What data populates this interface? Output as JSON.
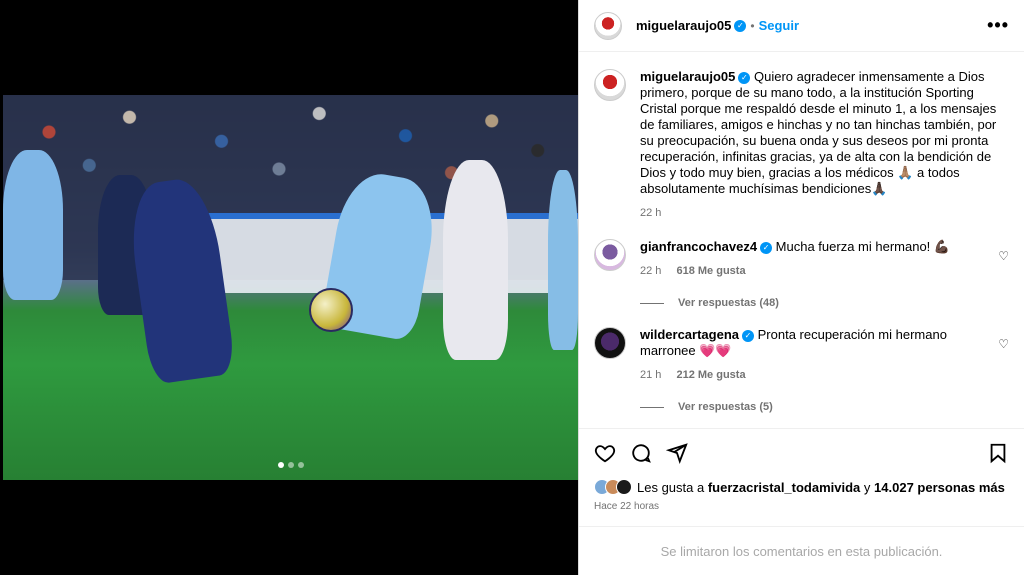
{
  "post": {
    "username": "miguelaraujo05",
    "follow_label": "Seguir",
    "separator": "•",
    "more_label": "•••"
  },
  "caption": {
    "username": "miguelaraujo05",
    "text": "Quiero agradecer inmensamente a Dios primero, porque de su mano todo, a la institución Sporting Cristal porque me respaldó desde el minuto 1, a los mensajes de familiares, amigos e hinchas y no tan hinchas también, por su preocupación, su buena onda y sus deseos por mi pronta recuperación, infinitas gracias, ya de alta con la bendición de Dios y todo muy bien, gracias a los médicos 🙏🏽 a todos absolutamente muchísimas bendiciones🙏🏿",
    "time": "22 h"
  },
  "comments": [
    {
      "username": "gianfrancochavez4",
      "text": "Mucha fuerza mi hermano! 💪🏿",
      "time": "22 h",
      "likes": "618 Me gusta",
      "replies": "Ver respuestas (48)"
    },
    {
      "username": "wildercartagena",
      "text": "Pronta recuperación mi hermano marronee 💗💗",
      "time": "21 h",
      "likes": "212 Me gusta",
      "replies": "Ver respuestas (5)"
    }
  ],
  "likes": {
    "prefix": "Les gusta a",
    "first_user": "fuerzacristal_todamivida",
    "middle": "y",
    "others": "14.027 personas más",
    "ago": "Hace 22 horas"
  },
  "comments_limited": "Se limitaron los comentarios en esta publicación.",
  "icons": {
    "verified": "verified-badge-icon",
    "heart": "heart-icon",
    "comment": "comment-icon",
    "share": "share-icon",
    "save": "bookmark-icon",
    "more": "more-options-icon"
  },
  "carousel": {
    "count": 3,
    "active": 1
  },
  "colors": {
    "accent": "#0095f6",
    "muted": "#737373"
  }
}
